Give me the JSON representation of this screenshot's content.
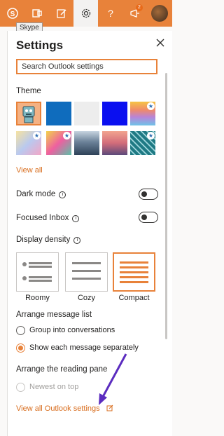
{
  "topbar": {
    "tooltip": "Skype",
    "notification_count": "2"
  },
  "settings": {
    "title": "Settings",
    "search_placeholder": "Search Outlook settings",
    "theme_heading": "Theme",
    "view_all": "View all",
    "dark_mode_label": "Dark mode",
    "focused_inbox_label": "Focused Inbox",
    "display_density_label": "Display density",
    "density_options": [
      "Roomy",
      "Cozy",
      "Compact"
    ],
    "selected_density": "Compact",
    "arrange_list_heading": "Arrange message list",
    "arrange_list_options": [
      "Group into conversations",
      "Show each message separately"
    ],
    "selected_arrange_list": "Show each message separately",
    "reading_pane_heading": "Arrange the reading pane",
    "reading_pane_option": "Newest on top",
    "view_all_settings": "View all Outlook settings"
  },
  "colors": {
    "accent": "#e8823a",
    "link": "#d86c1c"
  }
}
